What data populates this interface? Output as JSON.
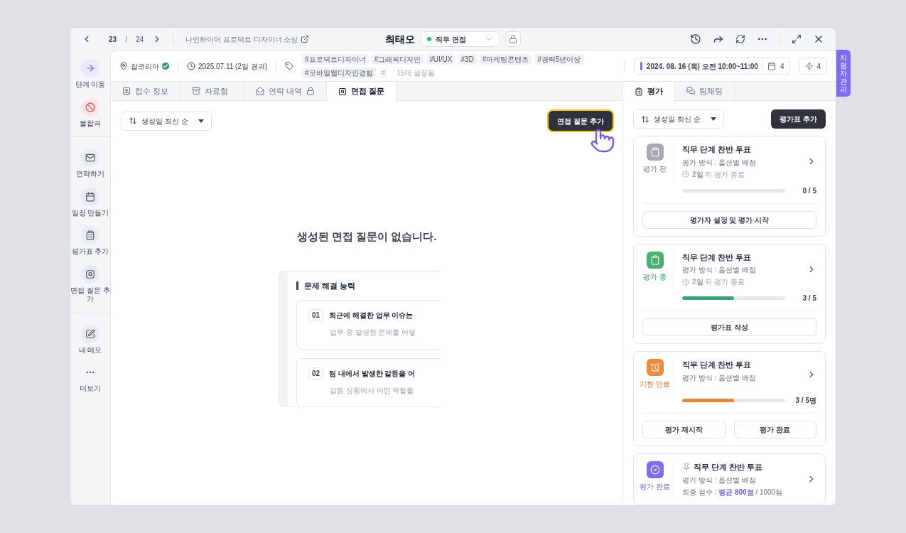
{
  "topbar": {
    "page_current": "23",
    "page_separator": "/",
    "page_total": "24",
    "job_title": "나인하이어 프로덕트 디자이너 소싱",
    "candidate_name": "최태오",
    "stage": {
      "label": "직무 면접",
      "color": "#22c55e"
    }
  },
  "info_bar": {
    "source": "잡코리아",
    "source_verified": true,
    "date": "2025.07.11 (2일 경과)",
    "tags": [
      {
        "label": "#프로덕트디자이너",
        "faded": false
      },
      {
        "label": "#그래픽디자인",
        "faded": false
      },
      {
        "label": "#UI/UX",
        "faded": false
      },
      {
        "label": "#3D",
        "faded": false
      },
      {
        "label": "#마케팅콘텐츠",
        "faded": false
      },
      {
        "label": "#경력5년이상",
        "faded": false
      },
      {
        "label": "#모바일웹디자인경험",
        "faded": false
      },
      {
        "label": "#",
        "faded": true
      }
    ],
    "tags_count": "15개 설정됨",
    "schedule": "2024. 08. 16 (목) 오전 10:00~11:00",
    "schedule_count": "4",
    "flash_count": "4"
  },
  "sidebar": {
    "groups": [
      [
        {
          "label": "단계 이동",
          "kind": "primary"
        },
        {
          "label": "불합격",
          "kind": "danger"
        }
      ],
      [
        {
          "label": "연락하기",
          "kind": "default"
        },
        {
          "label": "일정 만들기",
          "kind": "default"
        },
        {
          "label": "평가표 추가",
          "kind": "default"
        },
        {
          "label": "면접 질문 추가",
          "kind": "default"
        }
      ],
      [
        {
          "label": "내 메모",
          "kind": "default"
        },
        {
          "label": "더보기",
          "kind": "plain"
        }
      ]
    ]
  },
  "tabs": [
    {
      "label": "접수 정보",
      "selected": false,
      "locked": false
    },
    {
      "label": "자료함",
      "selected": false,
      "locked": false
    },
    {
      "label": "연락 내역",
      "selected": false,
      "locked": true
    },
    {
      "label": "면접 질문",
      "selected": true,
      "locked": false
    }
  ],
  "main": {
    "sort": "생성일 최신 순",
    "add_button": "면접 질문 추가",
    "empty_message": "생성된 면접 질문이 없습니다.",
    "preview": {
      "title": "문제 해결 능력",
      "questions": [
        {
          "number": "01",
          "title": "최근에 해결한 업무 이슈는",
          "description": "업무 중 발생한 문제를 어떻"
        },
        {
          "number": "02",
          "title": "팀 내에서 발생한 갈등을 어",
          "description": "갈등 상황에서 어떤 역할을"
        }
      ]
    }
  },
  "side_panel": {
    "tabs": [
      {
        "label": "평가",
        "selected": true
      },
      {
        "label": "팀채팅",
        "selected": false
      }
    ],
    "sort": "생성일 최신 순",
    "add_button": "평가표 추가",
    "cards": [
      {
        "kind": "before",
        "status": "평가 전",
        "title": "직무 단계 찬반 투표",
        "pinned": false,
        "method": "평가 방식 : 옵션별 배점",
        "deadline": "**2일** 뒤 평가 종료",
        "level": 0,
        "count": "0 / 5",
        "buttons": [
          "평가자 설정 및 평가 시작"
        ]
      },
      {
        "kind": "progress",
        "status": "평가 중",
        "title": "직무 단계 찬반 투표",
        "pinned": false,
        "method": "평가 방식 : 옵션별 배점",
        "deadline": "**2일** 뒤 평가 종료",
        "level": 0.5,
        "count": "3 / 5",
        "buttons": [
          "평가표 작성"
        ]
      },
      {
        "kind": "expired",
        "status": "기한 만료",
        "title": "직무 단계 찬반 투표",
        "pinned": false,
        "method": "평가 방식 : 옵션별 배점",
        "level": 0.5,
        "count": "3 / 5명",
        "buttons": [
          "평가 재시작",
          "평가 완료"
        ]
      },
      {
        "kind": "done",
        "status": "평가 완료",
        "title": "직무 단계 찬반 투표",
        "pinned": true,
        "method": "평가 방식 : 옵션별 배점",
        "score": "최종 점수 : **평균 800점** / 1000점"
      }
    ]
  },
  "side_tab": "지원자 관리"
}
